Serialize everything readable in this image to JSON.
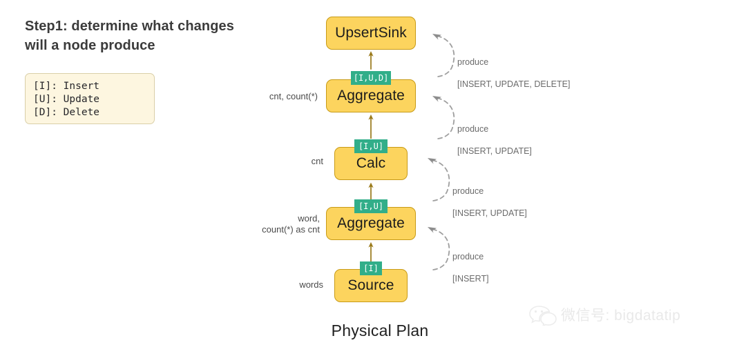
{
  "title": "Step1: determine what changes\n will a node produce",
  "legend": {
    "name": "change-type-legend",
    "lines": [
      "[I]: Insert",
      "[U]: Update",
      "[D]: Delete"
    ]
  },
  "caption": "Physical Plan",
  "watermark": {
    "icon": "wechat-icon",
    "text": "微信号: bigdatatip"
  },
  "colors": {
    "node_fill": "#fcd45e",
    "node_border": "#c79a16",
    "badge_fill": "#31ae89",
    "badge_text": "#ffffff",
    "connector": "#9a7a1b",
    "legend_fill": "#fdf6e0",
    "legend_border": "#d9cfa8",
    "annotation": "#6b6b6b",
    "title": "#3b3b3b"
  },
  "flow": {
    "nodes": [
      {
        "id": "upsert-sink",
        "label": "UpsertSink",
        "badge": null,
        "field_label": ""
      },
      {
        "id": "aggregate-top",
        "label": "Aggregate",
        "badge": "[I,U,D]",
        "field_label": "cnt, count(*)"
      },
      {
        "id": "calc",
        "label": "Calc",
        "badge": "[I,U]",
        "field_label": "cnt"
      },
      {
        "id": "aggregate-bottom",
        "label": "Aggregate",
        "badge": "[I,U]",
        "field_label": "word,\ncount(*) as cnt"
      },
      {
        "id": "source",
        "label": "Source",
        "badge": "[I]",
        "field_label": "words"
      }
    ]
  },
  "annotations": [
    {
      "id": "produce-upsert-sink",
      "verb": "produce",
      "changes": "[INSERT, UPDATE, DELETE]"
    },
    {
      "id": "produce-aggregate-top",
      "verb": "produce",
      "changes": "[INSERT, UPDATE]"
    },
    {
      "id": "produce-calc",
      "verb": "produce",
      "changes": "[INSERT, UPDATE]"
    },
    {
      "id": "produce-aggregate-bottom",
      "verb": "produce",
      "changes": "[INSERT]"
    }
  ]
}
